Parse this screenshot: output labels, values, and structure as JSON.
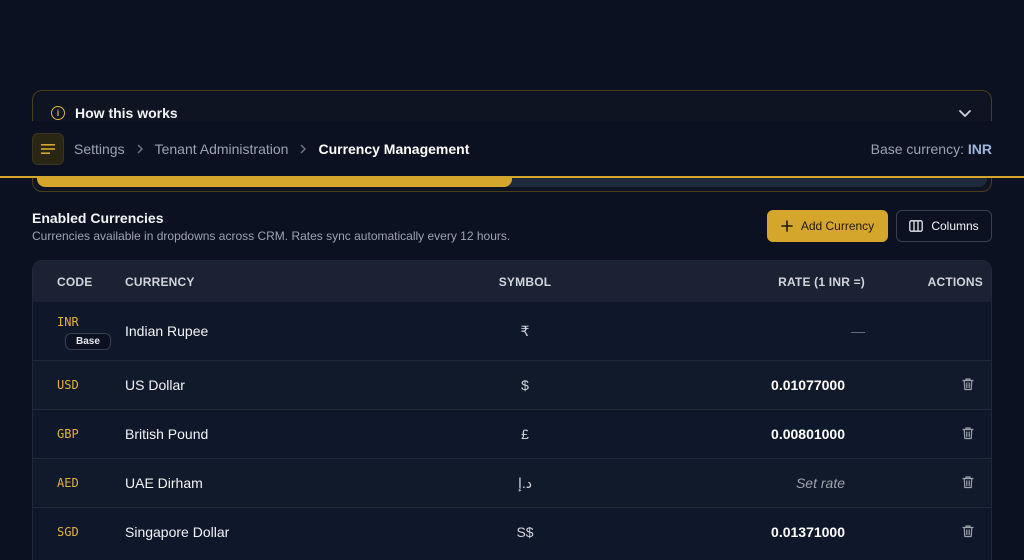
{
  "how_it_works": {
    "title": "How this works",
    "progress": 0.5
  },
  "header": {
    "breadcrumbs": [
      "Settings",
      "Tenant Administration",
      "Currency Management"
    ],
    "base_currency_label": "Base currency:",
    "base_currency_code": "INR"
  },
  "section": {
    "title": "Enabled Currencies",
    "subtitle": "Currencies available in dropdowns across CRM. Rates sync automatically every 12 hours.",
    "add_button": "Add Currency",
    "columns_button": "Columns"
  },
  "table": {
    "columns": [
      "CODE",
      "CURRENCY",
      "SYMBOL",
      "RATE (1 INR =)",
      "ACTIONS"
    ],
    "rows": [
      {
        "code": "INR",
        "badge": "Base",
        "name": "Indian Rupee",
        "symbol": "₹",
        "rate": "—"
      },
      {
        "code": "USD",
        "name": "US Dollar",
        "symbol": "$",
        "rate": "0.01077000"
      },
      {
        "code": "GBP",
        "name": "British Pound",
        "symbol": "£",
        "rate": "0.00801000"
      },
      {
        "code": "AED",
        "name": "UAE Dirham",
        "symbol": "د.إ",
        "rate": "Set rate"
      },
      {
        "code": "SGD",
        "name": "Singapore Dollar",
        "symbol": "S$",
        "rate": "0.01371000"
      }
    ]
  },
  "colors": {
    "accent": "#d4a72c",
    "background": "#0b1120",
    "code_color": "#e0b43a"
  },
  "icons": [
    "info-icon",
    "chevron-down-icon",
    "menu-icon",
    "chevron-right-icon",
    "plus-icon",
    "columns-icon",
    "trash-icon"
  ]
}
